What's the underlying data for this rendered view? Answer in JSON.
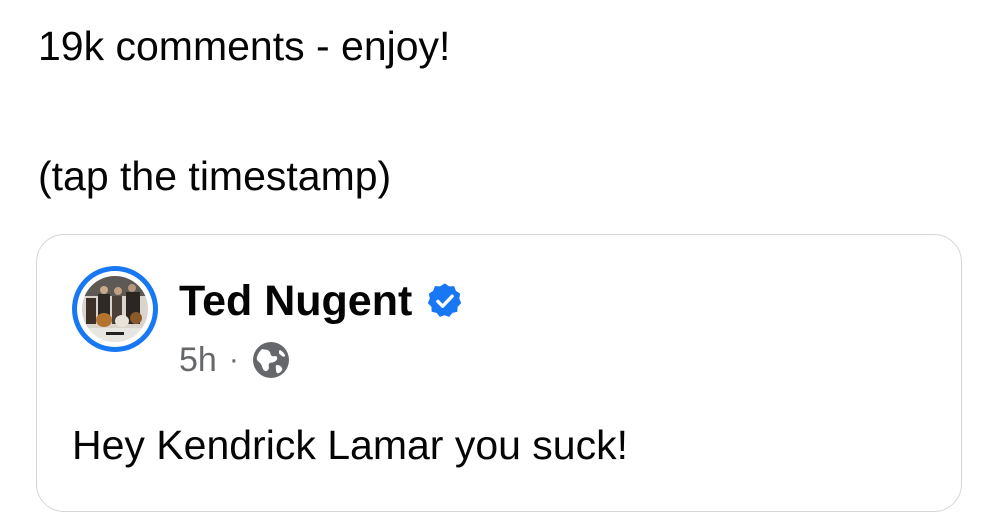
{
  "post": {
    "line_1": "19k comments - enjoy!",
    "line_2": "(tap the timestamp)"
  },
  "shared_post": {
    "author": "Ted Nugent",
    "verified": true,
    "timestamp": "5h",
    "separator": "·",
    "audience_icon": "globe-icon",
    "body": "Hey Kendrick Lamar you suck!"
  },
  "colors": {
    "accent": "#1877f2",
    "text": "#050505",
    "meta": "#65676b",
    "card_border": "#d4d6da"
  }
}
